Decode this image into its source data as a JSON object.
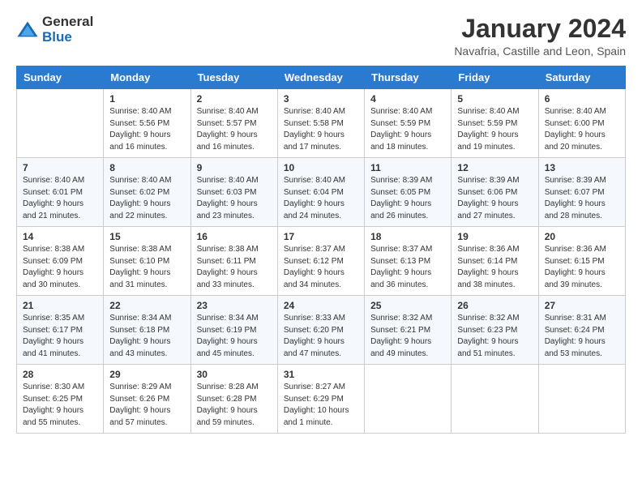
{
  "logo": {
    "general": "General",
    "blue": "Blue"
  },
  "header": {
    "title": "January 2024",
    "subtitle": "Navafria, Castille and Leon, Spain"
  },
  "columns": [
    "Sunday",
    "Monday",
    "Tuesday",
    "Wednesday",
    "Thursday",
    "Friday",
    "Saturday"
  ],
  "weeks": [
    [
      {
        "day": "",
        "content": ""
      },
      {
        "day": "1",
        "content": "Sunrise: 8:40 AM\nSunset: 5:56 PM\nDaylight: 9 hours\nand 16 minutes."
      },
      {
        "day": "2",
        "content": "Sunrise: 8:40 AM\nSunset: 5:57 PM\nDaylight: 9 hours\nand 16 minutes."
      },
      {
        "day": "3",
        "content": "Sunrise: 8:40 AM\nSunset: 5:58 PM\nDaylight: 9 hours\nand 17 minutes."
      },
      {
        "day": "4",
        "content": "Sunrise: 8:40 AM\nSunset: 5:59 PM\nDaylight: 9 hours\nand 18 minutes."
      },
      {
        "day": "5",
        "content": "Sunrise: 8:40 AM\nSunset: 5:59 PM\nDaylight: 9 hours\nand 19 minutes."
      },
      {
        "day": "6",
        "content": "Sunrise: 8:40 AM\nSunset: 6:00 PM\nDaylight: 9 hours\nand 20 minutes."
      }
    ],
    [
      {
        "day": "7",
        "content": "Sunrise: 8:40 AM\nSunset: 6:01 PM\nDaylight: 9 hours\nand 21 minutes."
      },
      {
        "day": "8",
        "content": "Sunrise: 8:40 AM\nSunset: 6:02 PM\nDaylight: 9 hours\nand 22 minutes."
      },
      {
        "day": "9",
        "content": "Sunrise: 8:40 AM\nSunset: 6:03 PM\nDaylight: 9 hours\nand 23 minutes."
      },
      {
        "day": "10",
        "content": "Sunrise: 8:40 AM\nSunset: 6:04 PM\nDaylight: 9 hours\nand 24 minutes."
      },
      {
        "day": "11",
        "content": "Sunrise: 8:39 AM\nSunset: 6:05 PM\nDaylight: 9 hours\nand 26 minutes."
      },
      {
        "day": "12",
        "content": "Sunrise: 8:39 AM\nSunset: 6:06 PM\nDaylight: 9 hours\nand 27 minutes."
      },
      {
        "day": "13",
        "content": "Sunrise: 8:39 AM\nSunset: 6:07 PM\nDaylight: 9 hours\nand 28 minutes."
      }
    ],
    [
      {
        "day": "14",
        "content": "Sunrise: 8:38 AM\nSunset: 6:09 PM\nDaylight: 9 hours\nand 30 minutes."
      },
      {
        "day": "15",
        "content": "Sunrise: 8:38 AM\nSunset: 6:10 PM\nDaylight: 9 hours\nand 31 minutes."
      },
      {
        "day": "16",
        "content": "Sunrise: 8:38 AM\nSunset: 6:11 PM\nDaylight: 9 hours\nand 33 minutes."
      },
      {
        "day": "17",
        "content": "Sunrise: 8:37 AM\nSunset: 6:12 PM\nDaylight: 9 hours\nand 34 minutes."
      },
      {
        "day": "18",
        "content": "Sunrise: 8:37 AM\nSunset: 6:13 PM\nDaylight: 9 hours\nand 36 minutes."
      },
      {
        "day": "19",
        "content": "Sunrise: 8:36 AM\nSunset: 6:14 PM\nDaylight: 9 hours\nand 38 minutes."
      },
      {
        "day": "20",
        "content": "Sunrise: 8:36 AM\nSunset: 6:15 PM\nDaylight: 9 hours\nand 39 minutes."
      }
    ],
    [
      {
        "day": "21",
        "content": "Sunrise: 8:35 AM\nSunset: 6:17 PM\nDaylight: 9 hours\nand 41 minutes."
      },
      {
        "day": "22",
        "content": "Sunrise: 8:34 AM\nSunset: 6:18 PM\nDaylight: 9 hours\nand 43 minutes."
      },
      {
        "day": "23",
        "content": "Sunrise: 8:34 AM\nSunset: 6:19 PM\nDaylight: 9 hours\nand 45 minutes."
      },
      {
        "day": "24",
        "content": "Sunrise: 8:33 AM\nSunset: 6:20 PM\nDaylight: 9 hours\nand 47 minutes."
      },
      {
        "day": "25",
        "content": "Sunrise: 8:32 AM\nSunset: 6:21 PM\nDaylight: 9 hours\nand 49 minutes."
      },
      {
        "day": "26",
        "content": "Sunrise: 8:32 AM\nSunset: 6:23 PM\nDaylight: 9 hours\nand 51 minutes."
      },
      {
        "day": "27",
        "content": "Sunrise: 8:31 AM\nSunset: 6:24 PM\nDaylight: 9 hours\nand 53 minutes."
      }
    ],
    [
      {
        "day": "28",
        "content": "Sunrise: 8:30 AM\nSunset: 6:25 PM\nDaylight: 9 hours\nand 55 minutes."
      },
      {
        "day": "29",
        "content": "Sunrise: 8:29 AM\nSunset: 6:26 PM\nDaylight: 9 hours\nand 57 minutes."
      },
      {
        "day": "30",
        "content": "Sunrise: 8:28 AM\nSunset: 6:28 PM\nDaylight: 9 hours\nand 59 minutes."
      },
      {
        "day": "31",
        "content": "Sunrise: 8:27 AM\nSunset: 6:29 PM\nDaylight: 10 hours\nand 1 minute."
      },
      {
        "day": "",
        "content": ""
      },
      {
        "day": "",
        "content": ""
      },
      {
        "day": "",
        "content": ""
      }
    ]
  ]
}
